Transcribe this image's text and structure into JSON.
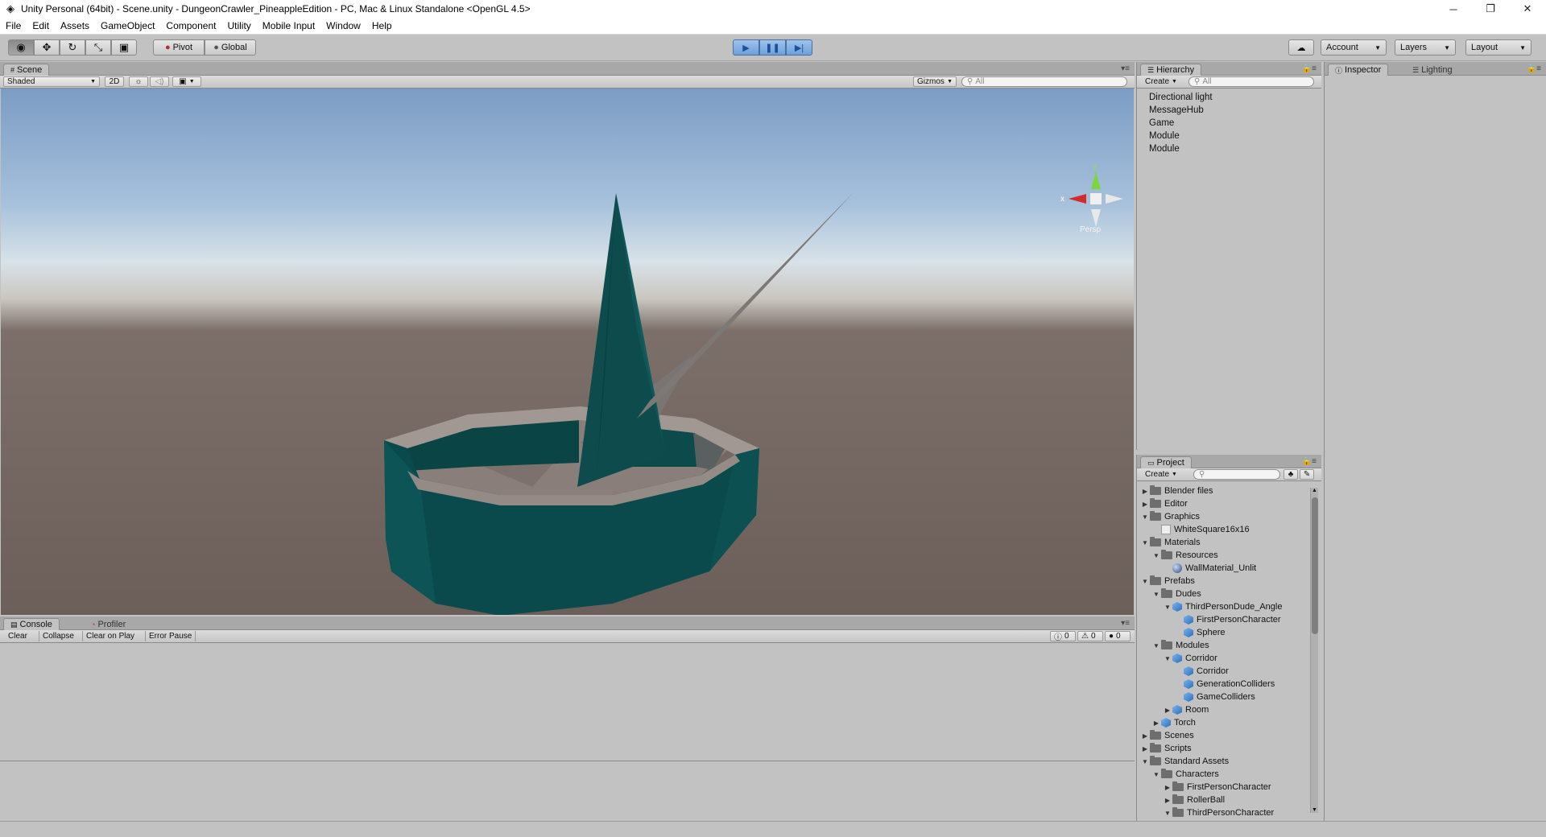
{
  "window": {
    "title": "Unity Personal (64bit) - Scene.unity - DungeonCrawler_PineappleEdition - PC, Mac & Linux Standalone <OpenGL 4.5>",
    "minimize": "─",
    "restore": "❐",
    "close": "✕"
  },
  "menu": [
    "File",
    "Edit",
    "Assets",
    "GameObject",
    "Component",
    "Utility",
    "Mobile Input",
    "Window",
    "Help"
  ],
  "toolbar": {
    "pivot": "Pivot",
    "global": "Global",
    "account": "Account",
    "layers": "Layers",
    "layout": "Layout"
  },
  "scene": {
    "tab": "Scene",
    "shading": "Shaded",
    "mode_2d": "2D",
    "gizmos": "Gizmos",
    "search_placeholder": "All",
    "persp_label": "Persp",
    "gizmo_y": "y",
    "gizmo_x": "x"
  },
  "console": {
    "tab": "Console",
    "profiler_tab": "Profiler",
    "clear": "Clear",
    "collapse": "Collapse",
    "clear_on_play": "Clear on Play",
    "error_pause": "Error Pause",
    "info_count": "0",
    "warning_count": "0",
    "error_count": "0"
  },
  "hierarchy": {
    "tab": "Hierarchy",
    "create": "Create",
    "search_placeholder": "All",
    "items": [
      "Directional light",
      "MessageHub",
      "Game",
      "Module",
      "Module"
    ]
  },
  "inspector": {
    "tab": "Inspector",
    "lighting_tab": "Lighting"
  },
  "project": {
    "tab": "Project",
    "create": "Create",
    "tree": [
      {
        "label": "Blender files",
        "depth": 0,
        "arrow": "right",
        "icon": "folder"
      },
      {
        "label": "Editor",
        "depth": 0,
        "arrow": "right",
        "icon": "folder"
      },
      {
        "label": "Graphics",
        "depth": 0,
        "arrow": "down",
        "icon": "folder"
      },
      {
        "label": "WhiteSquare16x16",
        "depth": 1,
        "arrow": "none",
        "icon": "texture"
      },
      {
        "label": "Materials",
        "depth": 0,
        "arrow": "down",
        "icon": "folder"
      },
      {
        "label": "Resources",
        "depth": 1,
        "arrow": "down",
        "icon": "folder"
      },
      {
        "label": "WallMaterial_Unlit",
        "depth": 2,
        "arrow": "none",
        "icon": "material"
      },
      {
        "label": "Prefabs",
        "depth": 0,
        "arrow": "down",
        "icon": "folder"
      },
      {
        "label": "Dudes",
        "depth": 1,
        "arrow": "down",
        "icon": "folder"
      },
      {
        "label": "ThirdPersonDude_Angle",
        "depth": 2,
        "arrow": "down",
        "icon": "prefab"
      },
      {
        "label": "FirstPersonCharacter",
        "depth": 3,
        "arrow": "none",
        "icon": "prefab"
      },
      {
        "label": "Sphere",
        "depth": 3,
        "arrow": "none",
        "icon": "prefab"
      },
      {
        "label": "Modules",
        "depth": 1,
        "arrow": "down",
        "icon": "folder"
      },
      {
        "label": "Corridor",
        "depth": 2,
        "arrow": "down",
        "icon": "prefab"
      },
      {
        "label": "Corridor",
        "depth": 3,
        "arrow": "none",
        "icon": "prefab"
      },
      {
        "label": "GenerationColliders",
        "depth": 3,
        "arrow": "none",
        "icon": "prefab"
      },
      {
        "label": "GameColliders",
        "depth": 3,
        "arrow": "none",
        "icon": "prefab"
      },
      {
        "label": "Room",
        "depth": 2,
        "arrow": "right",
        "icon": "prefab"
      },
      {
        "label": "Torch",
        "depth": 1,
        "arrow": "right",
        "icon": "prefab"
      },
      {
        "label": "Scenes",
        "depth": 0,
        "arrow": "right",
        "icon": "folder"
      },
      {
        "label": "Scripts",
        "depth": 0,
        "arrow": "right",
        "icon": "folder"
      },
      {
        "label": "Standard Assets",
        "depth": 0,
        "arrow": "down",
        "icon": "folder"
      },
      {
        "label": "Characters",
        "depth": 1,
        "arrow": "down",
        "icon": "folder"
      },
      {
        "label": "FirstPersonCharacter",
        "depth": 2,
        "arrow": "right",
        "icon": "folder"
      },
      {
        "label": "RollerBall",
        "depth": 2,
        "arrow": "right",
        "icon": "folder"
      },
      {
        "label": "ThirdPersonCharacter",
        "depth": 2,
        "arrow": "down",
        "icon": "folder"
      }
    ]
  },
  "colors": {
    "editor_bg": "#c2c2c2",
    "play_blue": "#6f9fd8",
    "teal_geometry": "#0e4b4d",
    "ground": "#6e605a",
    "sky_top": "#7f9ec4"
  }
}
